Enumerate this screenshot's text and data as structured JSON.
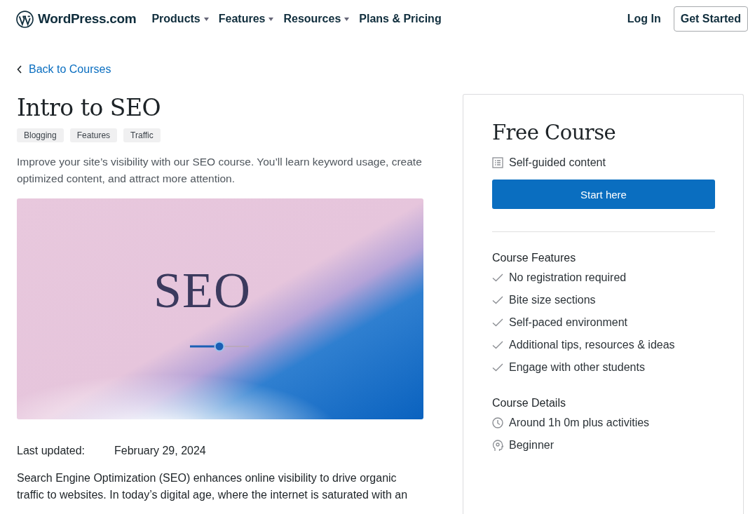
{
  "header": {
    "logo": "WordPress.com",
    "nav": [
      {
        "label": "Products",
        "dropdown": true
      },
      {
        "label": "Features",
        "dropdown": true
      },
      {
        "label": "Resources",
        "dropdown": true
      },
      {
        "label": "Plans & Pricing",
        "dropdown": false
      }
    ],
    "login": "Log In",
    "cta": "Get Started"
  },
  "back_link": "Back to Courses",
  "course": {
    "title": "Intro to SEO",
    "tags": [
      "Blogging",
      "Features",
      "Traffic"
    ],
    "summary": "Improve your site’s visibility with our SEO course. You’ll learn keyword usage, create optimized content, and attract more attention.",
    "hero": {
      "title": "SEO"
    },
    "last_updated_label": "Last updated:",
    "last_updated": "February 29, 2024",
    "description": "Search Engine Optimization (SEO) enhances online visibility to drive organic traffic to websites. In today’s digital age, where the internet is saturated with an"
  },
  "sidebar": {
    "title": "Free Course",
    "content_type": "Self-guided content",
    "button": "Start here",
    "features_heading": "Course Features",
    "features": [
      "No registration required",
      "Bite size sections",
      "Self-paced environment",
      "Additional tips, resources & ideas",
      "Engage with other students"
    ],
    "details_heading": "Course Details",
    "details": [
      {
        "kind": "duration",
        "text": "Around 1h 0m plus activities"
      },
      {
        "kind": "level",
        "text": "Beginner"
      }
    ]
  }
}
